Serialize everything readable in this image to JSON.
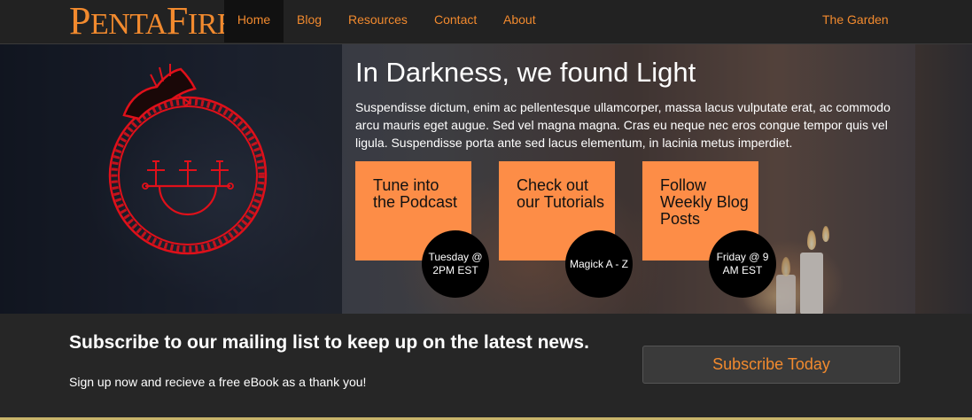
{
  "brand": {
    "name": "PentaFire",
    "color": "#f28a2e"
  },
  "nav": {
    "items": [
      {
        "label": "Home",
        "active": true
      },
      {
        "label": "Blog"
      },
      {
        "label": "Resources"
      },
      {
        "label": "Contact"
      },
      {
        "label": "About"
      }
    ],
    "right_item": "The Garden"
  },
  "hero": {
    "title": "In Darkness, we found Light",
    "text": "Suspendisse dictum, enim ac pellentesque ullamcorper, massa lacus vulputate erat, ac commodo arcu mauris eget augue. Sed vel magna magna. Cras eu neque nec eros congue tempor quis vel ligula. Suspendisse porta ante sed lacus elementum, in lacinia metus imperdiet.",
    "emblem_icon": "ouroboros-sigil-icon",
    "cards": [
      {
        "label": "Tune into the Podcast",
        "badge": "Tuesday @ 2PM EST"
      },
      {
        "label": "Check out our Tutorials",
        "badge": "Magick A - Z"
      },
      {
        "label": "Follow Weekly Blog Posts",
        "badge": "Friday @ 9 AM EST"
      }
    ],
    "card_color": "#fd8d47"
  },
  "subscribe": {
    "heading": "Subscribe to our mailing list to keep up on the latest news.",
    "text": "Sign up now and recieve a free eBook as a thank you!",
    "button": "Subscribe Today"
  }
}
